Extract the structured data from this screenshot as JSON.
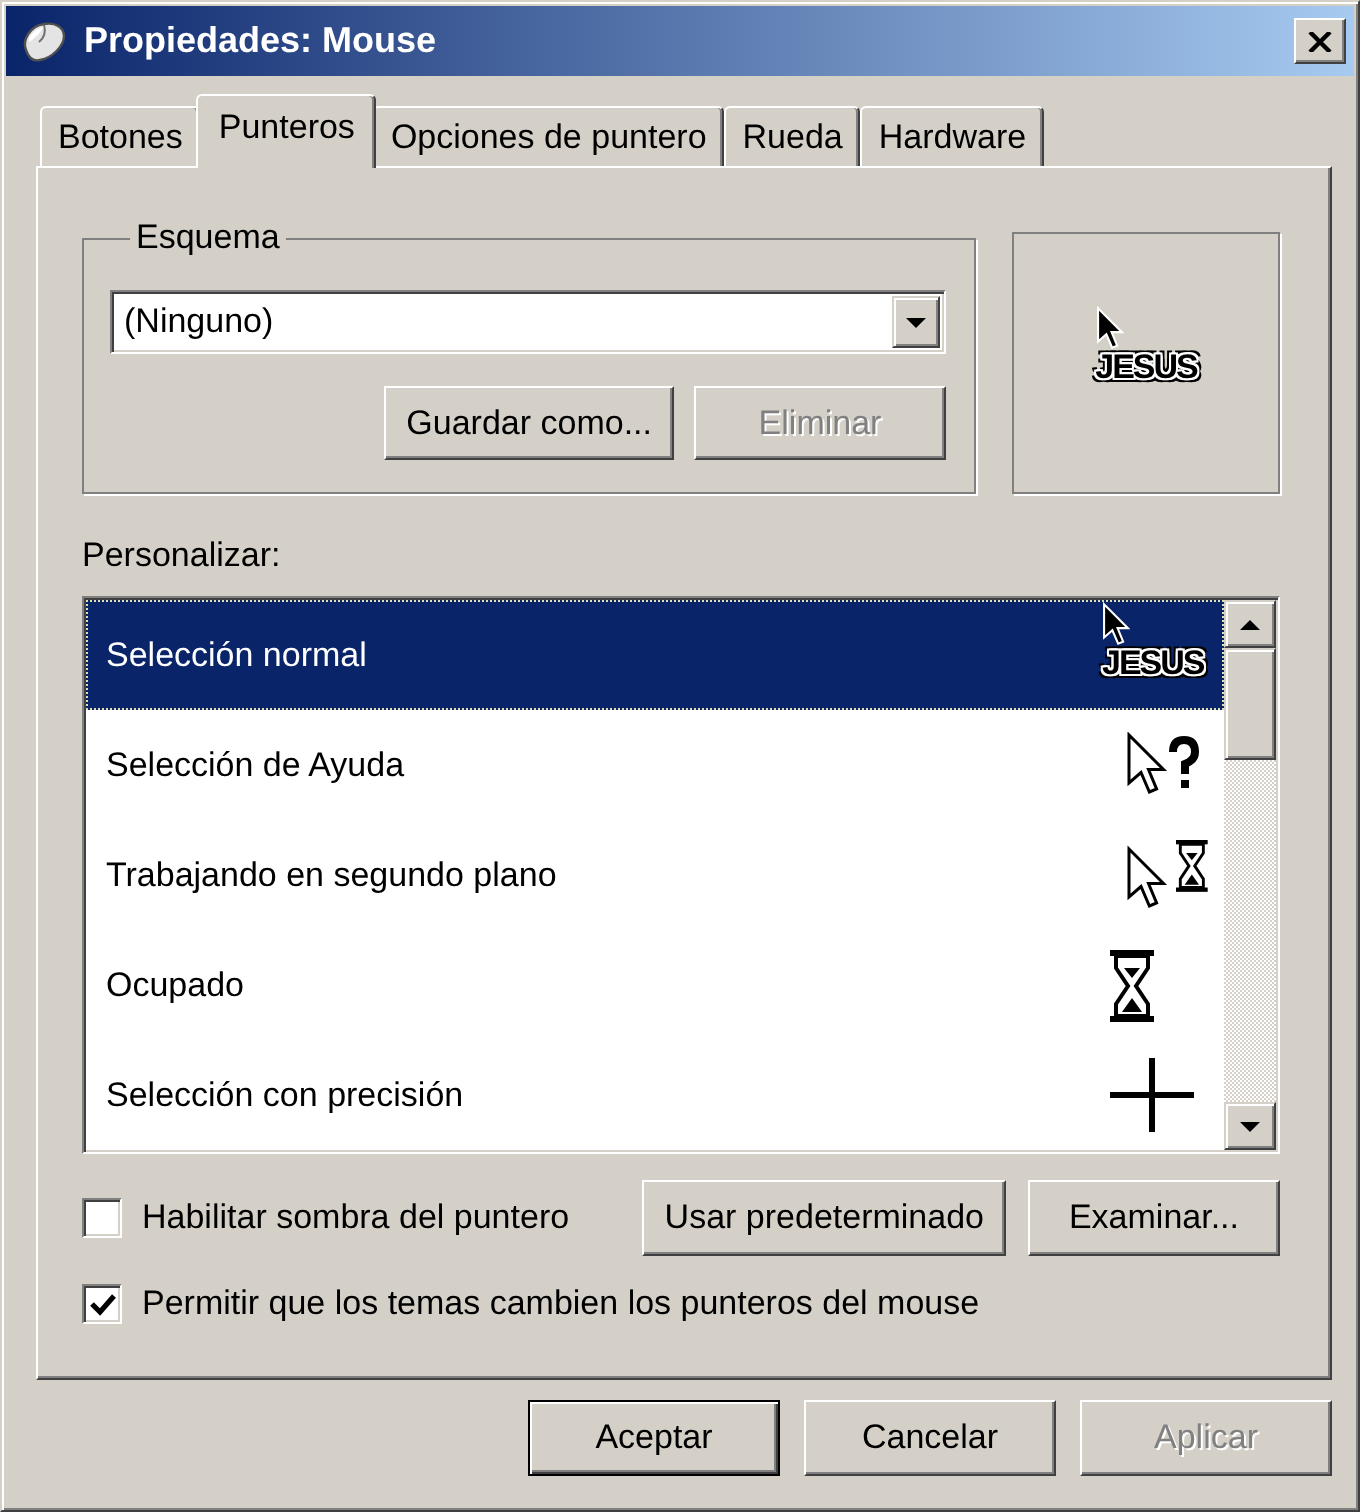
{
  "window": {
    "title": "Propiedades: Mouse"
  },
  "tabs": [
    {
      "label": "Botones",
      "selected": false
    },
    {
      "label": "Punteros",
      "selected": true
    },
    {
      "label": "Opciones de puntero",
      "selected": false
    },
    {
      "label": "Rueda",
      "selected": false
    },
    {
      "label": "Hardware",
      "selected": false
    }
  ],
  "scheme": {
    "label": "Esquema",
    "value": "(Ninguno)",
    "buttons": [
      {
        "label": "Guardar como...",
        "disabled": false
      },
      {
        "label": "Eliminar",
        "disabled": true
      }
    ]
  },
  "preview": {
    "cursor_text": "JESUS"
  },
  "customize": {
    "label": "Personalizar:",
    "items": [
      {
        "name": "Selección normal",
        "kind": "normal",
        "cursor_text": "JESUS",
        "selected": true
      },
      {
        "name": "Selección de Ayuda",
        "kind": "help",
        "selected": false
      },
      {
        "name": "Trabajando en segundo plano",
        "kind": "working",
        "selected": false
      },
      {
        "name": "Ocupado",
        "kind": "busy",
        "selected": false
      },
      {
        "name": "Selección con precisión",
        "kind": "precision",
        "selected": false
      }
    ]
  },
  "options": [
    {
      "label": "Habilitar sombra del puntero",
      "checked": false
    },
    {
      "label": "Permitir que los temas cambien los punteros del mouse",
      "checked": true
    }
  ],
  "option_buttons": [
    "Usar predeterminado",
    "Examinar..."
  ],
  "dialog_buttons": [
    {
      "label": "Aceptar",
      "default": true,
      "disabled": false
    },
    {
      "label": "Cancelar",
      "default": false,
      "disabled": false
    },
    {
      "label": "Aplicar",
      "default": false,
      "disabled": true
    }
  ]
}
